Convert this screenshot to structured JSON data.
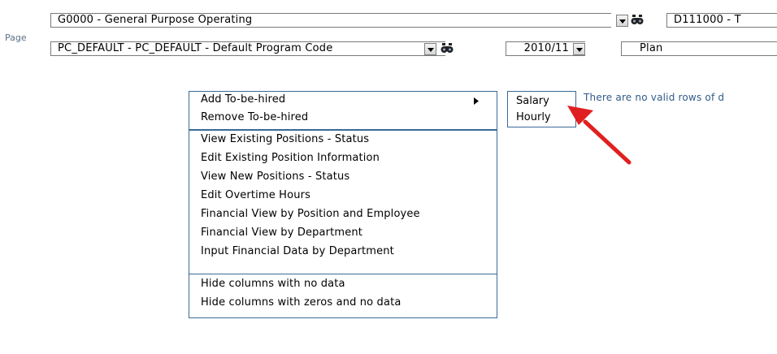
{
  "page_label": "Page",
  "fields": {
    "fund": "G0000 - General Purpose Operating",
    "dept": "D111000 - T",
    "program": "PC_DEFAULT - PC_DEFAULT - Default Program Code",
    "period": "2010/11",
    "scenario": "Plan"
  },
  "menu": {
    "items": [
      "Add To-be-hired",
      "Remove To-be-hired",
      "View Existing Positions - Status",
      "Edit Existing Position Information",
      "View New Positions - Status",
      "Edit Overtime Hours",
      "Financial View by Position and Employee",
      "Financial View by Department",
      "Input Financial Data by Department",
      "Hide columns with no data",
      "Hide columns with zeros and no data"
    ]
  },
  "submenu": {
    "items": [
      "Salary",
      "Hourly"
    ]
  },
  "message": "There are no valid rows of d",
  "colors": {
    "accent": "#3a6a96",
    "arrow": "#e02020"
  },
  "icons": [
    "binoculars-icon",
    "dropdown-arrow-icon",
    "submenu-arrow-icon",
    "annotation-arrow"
  ]
}
